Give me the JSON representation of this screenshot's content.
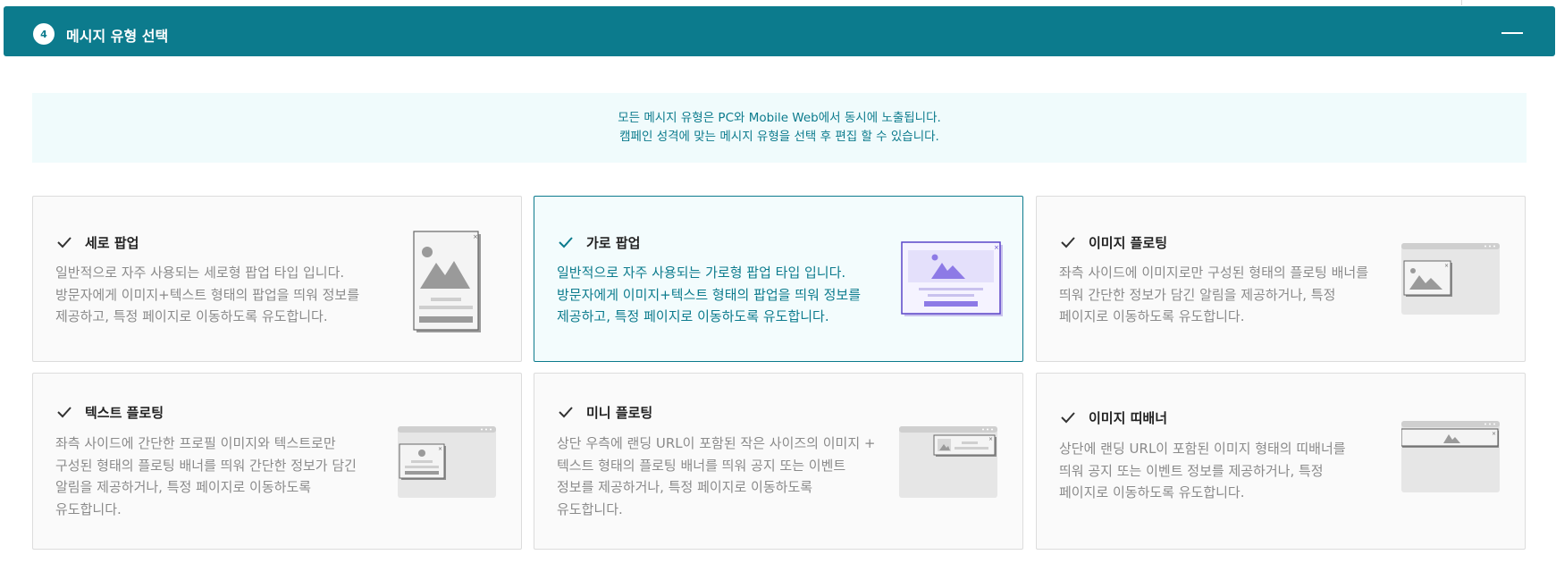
{
  "section": {
    "step_number": "4",
    "title": "메시지 유형 선택"
  },
  "notice": {
    "line1": "모든 메시지 유형은 PC와 Mobile Web에서 동시에 노출됩니다.",
    "line2": "캠페인 성격에 맞는 메시지 유형을 선택 후 편집 할 수 있습니다."
  },
  "colors": {
    "accent": "#0c7b8d",
    "selected_bg": "#f3fcfd",
    "illus_purple": "#5b45c8"
  },
  "cards": [
    {
      "title": "세로 팝업",
      "selected": false,
      "desc_lines": [
        "일반적으로 자주 사용되는 세로형 팝업 타입 입니다.",
        "방문자에게 이미지+텍스트 형태의 팝업을 띄워 정보를",
        "제공하고, 특정 페이지로 이동하도록 유도합니다."
      ],
      "icon": "vertical-popup-illustration"
    },
    {
      "title": "가로 팝업",
      "selected": true,
      "desc_lines": [
        "일반적으로 자주 사용되는 가로형 팝업 타입 입니다.",
        "방문자에게 이미지+텍스트 형태의 팝업을 띄워 정보를",
        "제공하고, 특정 페이지로 이동하도록 유도합니다."
      ],
      "icon": "horizontal-popup-illustration"
    },
    {
      "title": "이미지 플로팅",
      "selected": false,
      "desc_lines": [
        "좌측 사이드에 이미지로만 구성된 형태의 플로팅 배너를",
        "띄워 간단한 정보가 담긴 알림을 제공하거나, 특정",
        "페이지로 이동하도록 유도합니다."
      ],
      "icon": "image-floating-illustration"
    },
    {
      "title": "텍스트 플로팅",
      "selected": false,
      "desc_lines": [
        "좌측 사이드에 간단한 프로필 이미지와 텍스트로만",
        "구성된 형태의 플로팅 배너를 띄워 간단한 정보가 담긴",
        "알림을 제공하거나, 특정 페이지로 이동하도록",
        "유도합니다."
      ],
      "icon": "text-floating-illustration"
    },
    {
      "title": "미니 플로팅",
      "selected": false,
      "desc_lines": [
        "상단 우측에 랜딩 URL이 포함된 작은 사이즈의 이미지 +",
        "텍스트 형태의 플로팅 배너를 띄워 공지 또는 이벤트",
        "정보를 제공하거나, 특정 페이지로 이동하도록",
        "유도합니다."
      ],
      "icon": "mini-floating-illustration"
    },
    {
      "title": "이미지 띠배너",
      "selected": false,
      "desc_lines": [
        "상단에 랜딩 URL이 포함된 이미지 형태의 띠배너를",
        "띄워 공지 또는 이벤트 정보를 제공하거나, 특정",
        "페이지로 이동하도록 유도합니다."
      ],
      "icon": "image-strip-banner-illustration"
    }
  ]
}
